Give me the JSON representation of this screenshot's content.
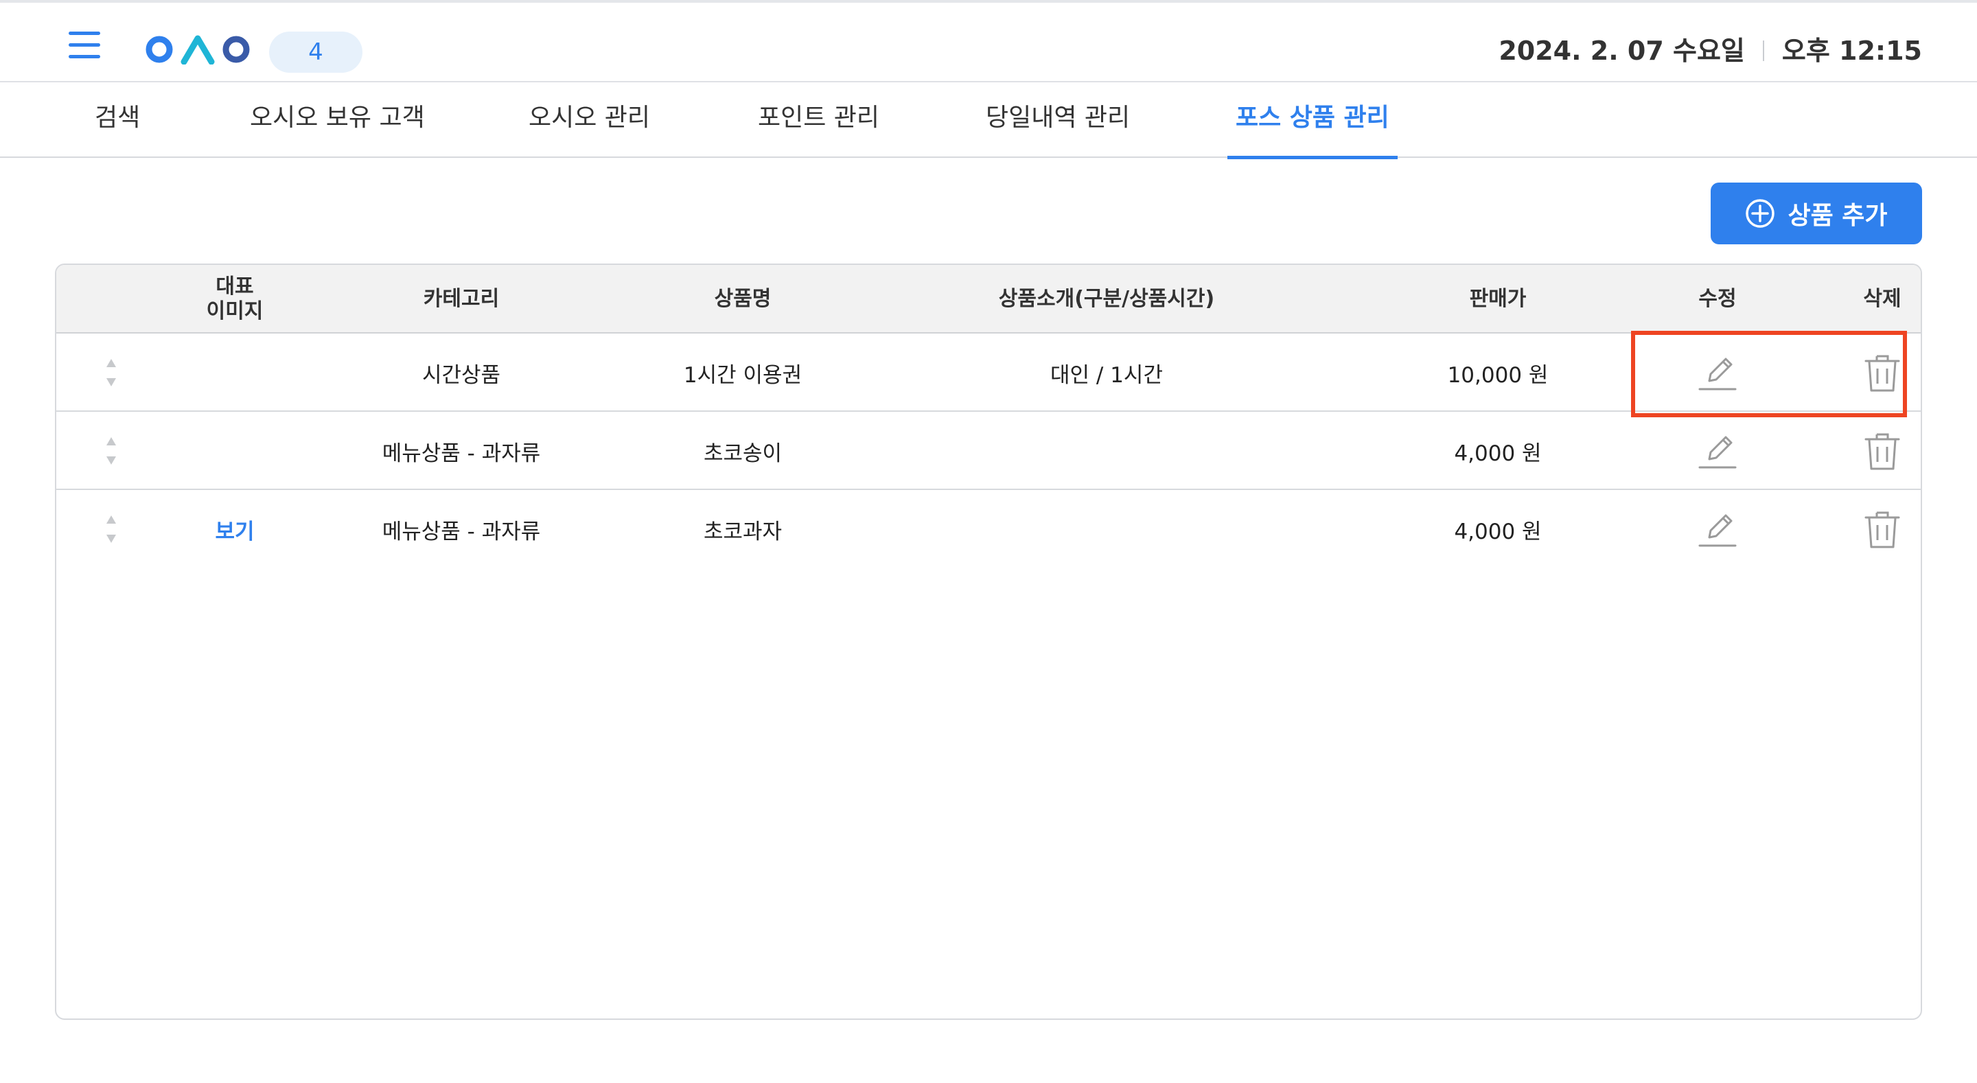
{
  "header": {
    "logo_text": "OAO",
    "count": "4",
    "date": "2024. 2. 07 수요일",
    "time": "오후 12:15"
  },
  "tabs": [
    {
      "label": "검색",
      "active": false
    },
    {
      "label": "오시오 보유 고객",
      "active": false
    },
    {
      "label": "오시오 관리",
      "active": false
    },
    {
      "label": "포인트 관리",
      "active": false
    },
    {
      "label": "당일내역 관리",
      "active": false
    },
    {
      "label": "포스 상품 관리",
      "active": true
    }
  ],
  "toolbar": {
    "add_label": "상품 추가"
  },
  "table": {
    "columns": {
      "image_line1": "대표",
      "image_line2": "이미지",
      "category": "카테고리",
      "name": "상품명",
      "desc": "상품소개(구분/상품시간)",
      "price": "판매가",
      "edit": "수정",
      "delete": "삭제"
    },
    "rows": [
      {
        "image": "",
        "category": "시간상품",
        "name": "1시간 이용권",
        "desc": "대인 / 1시간",
        "price": "10,000 원"
      },
      {
        "image": "",
        "category": "메뉴상품 - 과자류",
        "name": "초코송이",
        "desc": "",
        "price": "4,000 원"
      },
      {
        "image": "보기",
        "category": "메뉴상품 - 과자류",
        "name": "초코과자",
        "desc": "",
        "price": "4,000 원"
      }
    ]
  },
  "colors": {
    "accent": "#2f80ed",
    "highlight": "#ee4422",
    "icon_gray": "#9a9a9a"
  },
  "icons": [
    "menu-icon",
    "plus-circle-icon",
    "sort-icon",
    "pencil-icon",
    "trash-icon"
  ]
}
